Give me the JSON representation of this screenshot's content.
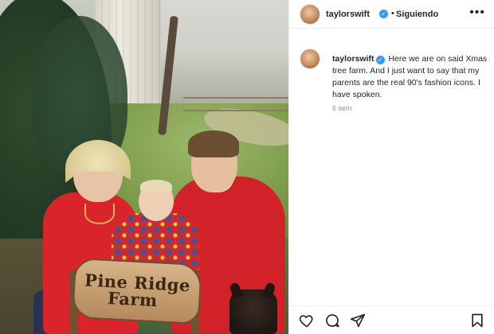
{
  "post": {
    "author": {
      "username": "taylorswift",
      "verified": true,
      "follow_status": "Siguiendo",
      "separator": "•"
    },
    "photo": {
      "sign_line1": "Pine Ridge",
      "sign_line2": "Farm"
    },
    "caption": {
      "username": "taylorswift",
      "text": "Here we are on said Xmas tree farm. And I just want to say that my parents are the real 90's fashion icons. I have spoken."
    },
    "time_ago": "6 sem",
    "actions": {
      "icons": [
        "heart-icon",
        "comment-icon",
        "share-icon",
        "bookmark-icon"
      ]
    }
  },
  "colors": {
    "verified_badge": "#3897f0",
    "text_primary": "#262626",
    "text_secondary": "#8e8e8e",
    "divider": "#efefef"
  }
}
